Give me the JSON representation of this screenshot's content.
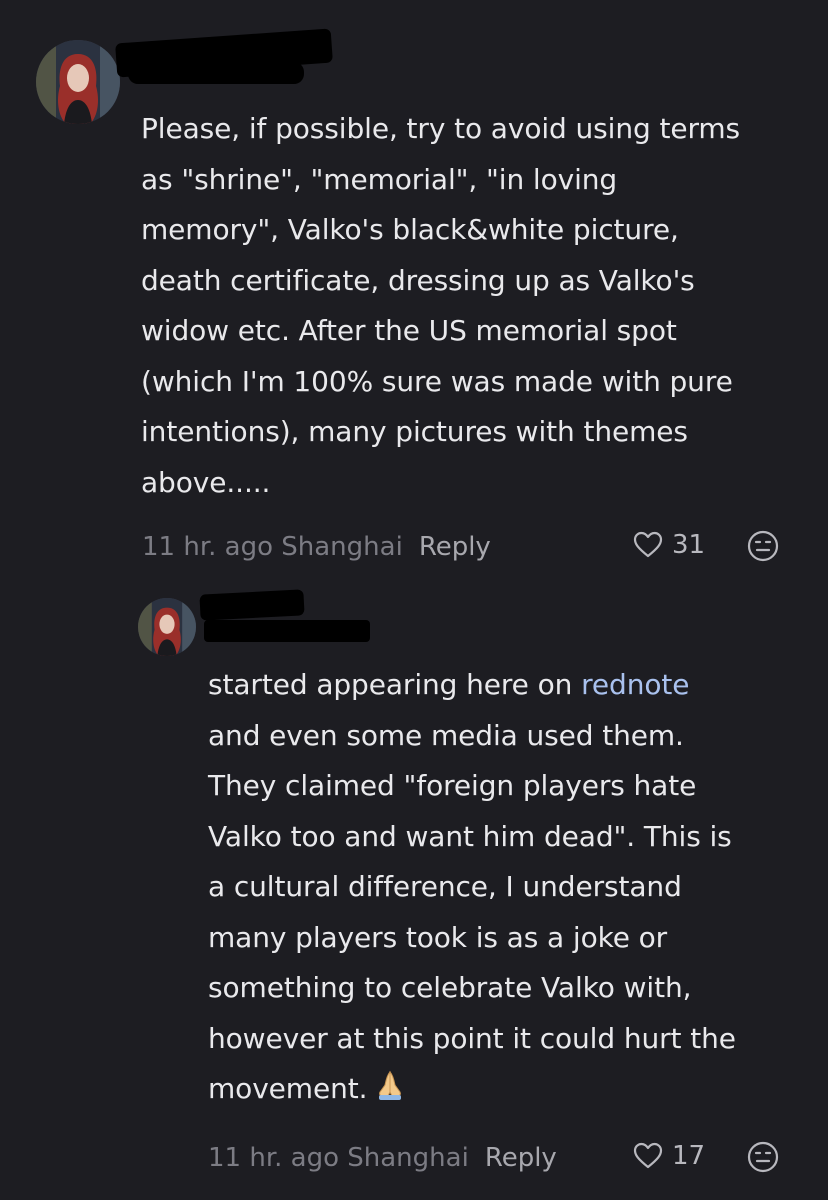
{
  "comments": [
    {
      "lines": [
        "Please, if possible, try to avoid using terms",
        "as \"shrine\", \"memorial\", \"in loving",
        "memory\", Valko's black&white picture,",
        "death certificate, dressing up as Valko's",
        "widow etc. After the US memorial spot",
        "(which I'm 100% sure was made with pure",
        "intentions), many pictures with themes",
        "above....."
      ],
      "time_location": "11 hr. ago Shanghai",
      "reply_label": "Reply",
      "likes": "31"
    },
    {
      "line1_pre": "started appearing here on ",
      "line1_link": "rednote",
      "lines": [
        "and even some media used them.",
        "They claimed \"foreign players hate",
        "Valko too and want him dead\". This is",
        "a cultural difference, I understand",
        "many players took is as a joke or",
        "something to celebrate Valko with,",
        "however at this point it could hurt the"
      ],
      "last_line": "movement.",
      "emoji": "🙏",
      "time_location": "11 hr. ago Shanghai",
      "reply_label": "Reply",
      "likes": "17"
    }
  ],
  "colors": {
    "background": "#1d1d22",
    "text": "#e9e9ec",
    "meta": "#7c7c84",
    "link": "#a9c1ee"
  },
  "icons": {
    "like": "heart-outline-icon",
    "react": "neutral-face-icon",
    "emoji": "folded-hands-emoji"
  }
}
